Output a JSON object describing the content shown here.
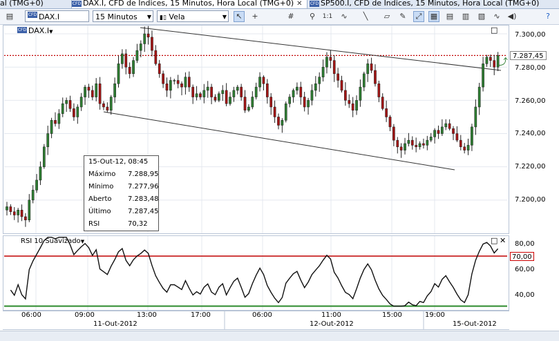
{
  "tabs": [
    {
      "label": "al (TMG+0)",
      "active": false
    },
    {
      "label": "DAX.I, CFD de Índices, 15 Minutos, Hora Local (TMG+0)",
      "active": true,
      "close": "✕"
    },
    {
      "label": "SP500.I, CFD de Índices, 15 Minutos, Hora Local (TMG+0)",
      "active": false
    }
  ],
  "toolbar": {
    "symbol": "DAX.I",
    "interval": "15 Minutos",
    "chart_type": "Vela"
  },
  "chart": {
    "symbol_label": "DAX.I",
    "price_axis": [
      "7.300,00",
      "7.280,00",
      "7.260,00",
      "7.240,00",
      "7.220,00",
      "7.200,00"
    ],
    "last_price_tag": "7.287,45",
    "rsi_title": "RSI 10 Suavizado",
    "rsi_axis": [
      "80,00",
      "60,00",
      "40,00"
    ],
    "rsi_level_tag": "70,00",
    "time_labels": [
      "06:00",
      "09:00",
      "13:00",
      "17:00",
      "06:00",
      "11:00",
      "15:00",
      "19:00"
    ],
    "date_labels": [
      "11-Out-2012",
      "12-Out-2012",
      "15-Out-2012"
    ]
  },
  "info_panel": {
    "datetime": "15-Out-12, 08:45",
    "rows": [
      {
        "label": "Máximo",
        "value": "7.288,95"
      },
      {
        "label": "Mínimo",
        "value": "7.277,96"
      },
      {
        "label": "Aberto",
        "value": "7.283,48"
      },
      {
        "label": "Último",
        "value": "7.287,45"
      },
      {
        "label": "RSI",
        "value": "70,32"
      }
    ]
  },
  "colors": {
    "bull": "#2e7d32",
    "bear": "#a31515",
    "overbought": "#c00000",
    "oversold": "#2a8a2a",
    "price_line": "#c00000"
  },
  "chart_data": {
    "type": "candlestick",
    "ylim": [
      7180,
      7305
    ],
    "rsi_ylim": [
      27,
      86
    ],
    "rsi_levels": [
      70,
      30
    ],
    "closes": [
      7196,
      7193,
      7191,
      7194,
      7190,
      7188,
      7200,
      7206,
      7212,
      7220,
      7232,
      7240,
      7248,
      7246,
      7252,
      7258,
      7260,
      7255,
      7250,
      7256,
      7262,
      7268,
      7266,
      7262,
      7270,
      7258,
      7256,
      7254,
      7262,
      7270,
      7282,
      7288,
      7280,
      7276,
      7284,
      7290,
      7294,
      7300,
      7298,
      7290,
      7282,
      7276,
      7270,
      7266,
      7272,
      7272,
      7270,
      7268,
      7274,
      7268,
      7262,
      7264,
      7262,
      7266,
      7268,
      7262,
      7260,
      7264,
      7266,
      7258,
      7262,
      7266,
      7268,
      7262,
      7254,
      7256,
      7262,
      7268,
      7274,
      7270,
      7262,
      7256,
      7250,
      7245,
      7248,
      7258,
      7262,
      7266,
      7268,
      7262,
      7256,
      7260,
      7266,
      7270,
      7274,
      7280,
      7286,
      7284,
      7276,
      7272,
      7266,
      7260,
      7258,
      7254,
      7260,
      7268,
      7276,
      7282,
      7278,
      7270,
      7262,
      7255,
      7250,
      7244,
      7236,
      7232,
      7230,
      7234,
      7236,
      7233,
      7232,
      7234,
      7233,
      7236,
      7238,
      7242,
      7240,
      7244,
      7246,
      7243,
      7240,
      7236,
      7232,
      7230,
      7233,
      7244,
      7256,
      7268,
      7282,
      7286,
      7284,
      7280,
      7287
    ]
  }
}
